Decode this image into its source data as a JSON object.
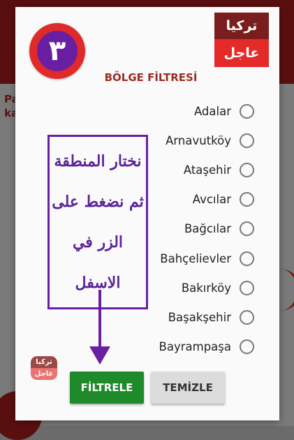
{
  "background": {
    "partial_text_line1": "Pa",
    "partial_text_line2": "ka"
  },
  "dialog": {
    "badge_number": "٣",
    "logo": {
      "top": "تركيا",
      "bottom": "عاجل"
    },
    "title": "BÖLGE FİLTRESİ",
    "districts": [
      "Adalar",
      "Arnavutköy",
      "Ataşehir",
      "Avcılar",
      "Bağcılar",
      "Bahçelievler",
      "Bakırköy",
      "Başakşehir",
      "Bayrampaşa"
    ],
    "annotation": {
      "line1": "نختار المنطقة",
      "line2": "ثم نضغط على",
      "line3": "الزر في الاسفل"
    },
    "watermark": {
      "top": "تركيا",
      "bottom": "عاجل"
    },
    "buttons": {
      "filter": "FİLTRELE",
      "clear": "TEMİZLE"
    }
  },
  "colors": {
    "title": "#9d2b26",
    "filter_button": "#1e8a2a",
    "annotation": "#6a1fa3",
    "badge_ring": "#e02a2a"
  }
}
